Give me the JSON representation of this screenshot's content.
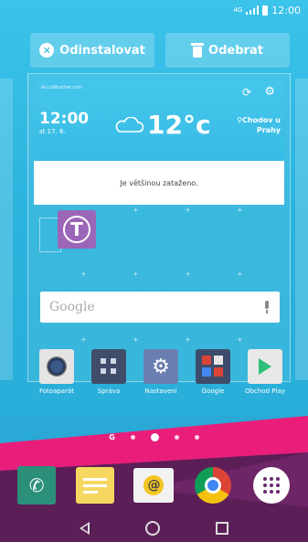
{
  "status_bar": {
    "time": "12:00",
    "network": "4G"
  },
  "actions": {
    "uninstall_label": "Odinstalovat",
    "remove_label": "Odebrat"
  },
  "weather": {
    "time": "12:00",
    "date": "st 17. 6.",
    "temperature": "12°c",
    "location_line1": "Chodov u",
    "location_line2": "Prahy",
    "description": "Je většinou zataženo.",
    "source": "AccuWeather.com"
  },
  "search": {
    "placeholder": "Google"
  },
  "apps": [
    {
      "label": "Fotoaparát",
      "icon": "camera-icon"
    },
    {
      "label": "Správa",
      "icon": "messaging-icon"
    },
    {
      "label": "Nastavení",
      "icon": "settings-icon"
    },
    {
      "label": "Google",
      "icon": "google-folder-icon"
    },
    {
      "label": "Obchod Play",
      "icon": "play-store-icon"
    }
  ],
  "pager": {
    "search_indicator": "G",
    "pages": 4,
    "active_page": 2
  },
  "dock": [
    "phone-icon",
    "memo-icon",
    "email-icon",
    "chrome-icon",
    "app-drawer-icon"
  ],
  "colors": {
    "background": "#2ab3dc",
    "band_pink": "#e91e7a",
    "band_purple": "#5b1e57",
    "tmobile": "#9b66b8"
  }
}
